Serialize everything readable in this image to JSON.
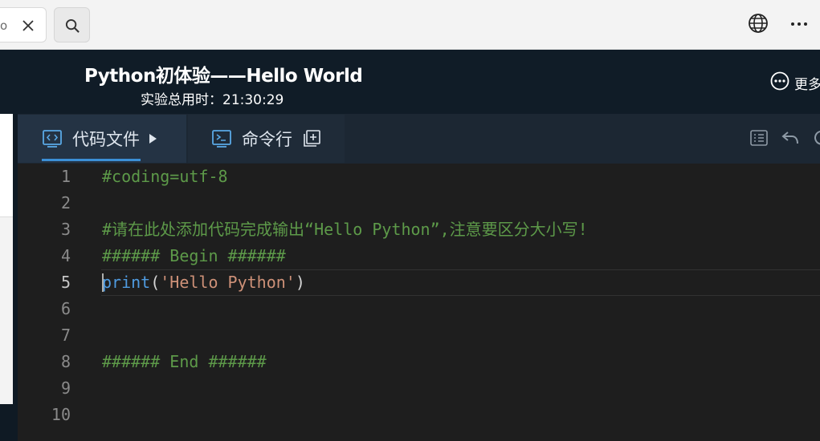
{
  "browser": {
    "tab_fragment_text": "o",
    "icons": [
      "close-icon",
      "search-icon",
      "globe-icon",
      "more-horizontal-icon"
    ]
  },
  "header": {
    "title": "Python初体验——Hello World",
    "timer": "实验总用时：21:30:29",
    "more_label": "更多"
  },
  "editor": {
    "tabs": [
      {
        "label": "代码文件",
        "icon": "code-file-icon",
        "active": true
      },
      {
        "label": "命令行",
        "icon": "terminal-icon",
        "active": false
      }
    ],
    "toolbar_icons": [
      "list-icon",
      "undo-icon",
      "reset-icon"
    ],
    "current_line": 5,
    "lines": [
      {
        "num": "1",
        "text": "#coding=utf-8"
      },
      {
        "num": "2",
        "text": ""
      },
      {
        "num": "3",
        "text": "#请在此处添加代码完成输出“Hello Python”,注意要区分大小写!"
      },
      {
        "num": "4",
        "text": "###### Begin ######"
      },
      {
        "num": "5",
        "fn": "print",
        "open": "(",
        "str": "'Hello Python'",
        "close": ")"
      },
      {
        "num": "6",
        "text": ""
      },
      {
        "num": "7",
        "text": ""
      },
      {
        "num": "8",
        "text": "###### End ######"
      },
      {
        "num": "9",
        "text": ""
      },
      {
        "num": "10",
        "text": ""
      }
    ]
  },
  "colors": {
    "comment": "#5d9a49",
    "function": "#4f9be0",
    "string": "#ce9178",
    "accent": "#3b8fd6",
    "editor_bg": "#1e1e1e",
    "header_bg": "#101c27"
  }
}
